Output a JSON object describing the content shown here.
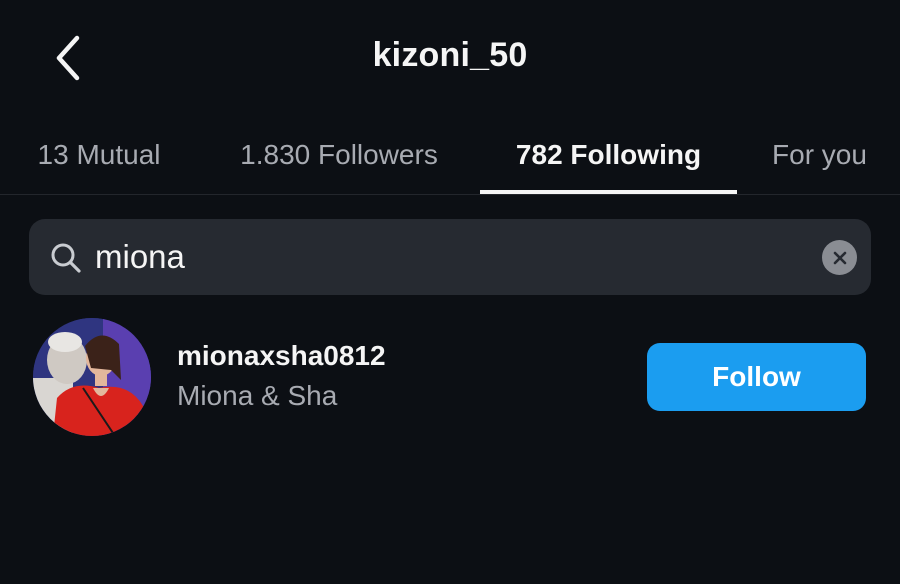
{
  "header": {
    "back_icon": "chevron-left-icon",
    "title": "kizoni_50"
  },
  "tabs": [
    {
      "label": "13 Mutual",
      "active": false
    },
    {
      "label": "1.830 Followers",
      "active": false
    },
    {
      "label": "782 Following",
      "active": true
    },
    {
      "label": "For you",
      "active": false
    }
  ],
  "search": {
    "icon": "search-icon",
    "value": "miona",
    "clear_icon": "clear-icon"
  },
  "results": [
    {
      "username": "mionaxsha0812",
      "full_name": "Miona & Sha",
      "button_label": "Follow"
    }
  ],
  "colors": {
    "background": "#0c0f14",
    "search_bg": "#262a31",
    "follow_button": "#1b9df0",
    "secondary_text": "#a8abb2"
  }
}
